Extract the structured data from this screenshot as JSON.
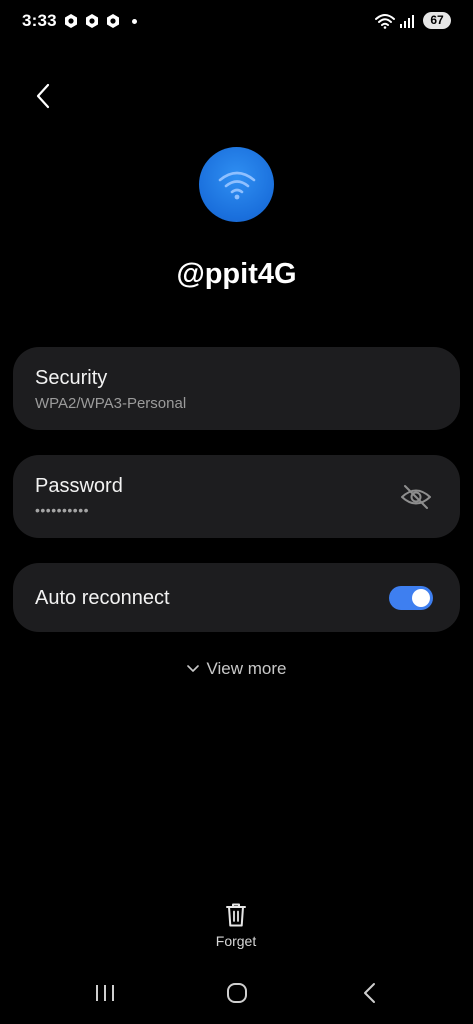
{
  "status_bar": {
    "time": "3:33",
    "battery": "67",
    "left_icons": [
      "hex-app-icon",
      "hex-app-icon",
      "hex-app-icon",
      "notification-dot"
    ],
    "right_icons": [
      "wifi-icon",
      "signal-icon",
      "battery-icon"
    ]
  },
  "header": {
    "back_icon": "chevron-left-icon"
  },
  "network": {
    "icon": "wifi-icon",
    "name": "@ppit4G",
    "avatar_color": "#1f77e0"
  },
  "security": {
    "title": "Security",
    "value": "WPA2/WPA3-Personal"
  },
  "password": {
    "title": "Password",
    "value": "••••••••••",
    "toggle_icon": "eye-off-icon"
  },
  "auto_reconnect": {
    "title": "Auto reconnect",
    "enabled": true,
    "accent_color": "#3e7ff0"
  },
  "view_more": {
    "label": "View more",
    "icon": "chevron-down-icon"
  },
  "forget": {
    "label": "Forget",
    "icon": "trash-icon"
  },
  "nav_bar": {
    "buttons": [
      "recents-icon",
      "home-icon",
      "back-icon"
    ]
  }
}
